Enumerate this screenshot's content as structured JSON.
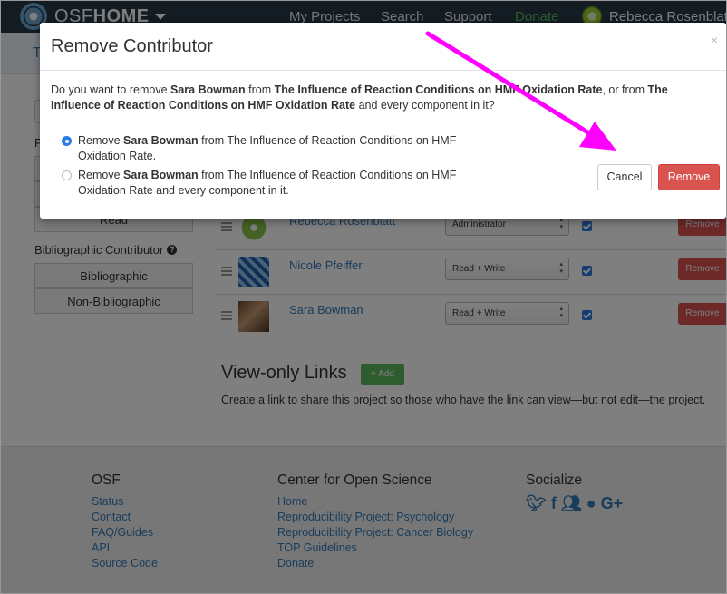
{
  "navbar": {
    "brand_osf": "OSF",
    "brand_home": "HOME",
    "links": [
      "My Projects",
      "Search",
      "Support",
      "Donate"
    ],
    "user_name": "Rebecca Rosenblatt"
  },
  "subnav": {
    "title_fragment": "T"
  },
  "sidebar": {
    "permission_label_fragment": "P",
    "read_label": "Read",
    "biblio_label": "Bibliographic Contributor",
    "biblio_options": [
      "Bibliographic",
      "Non-Bibliographic"
    ]
  },
  "contributors": [
    {
      "name": "Rebecca Rosenblatt",
      "permission": "Administrator",
      "remove": "Remove"
    },
    {
      "name": "Nicole Pfeiffer",
      "permission": "Read + Write",
      "remove": "Remove"
    },
    {
      "name": "Sara Bowman",
      "permission": "Read + Write",
      "remove": "Remove"
    }
  ],
  "view_only": {
    "title": "View-only Links",
    "add_label": "+ Add",
    "description": "Create a link to share this project so those who have the link can view—but not edit—the project."
  },
  "footer": {
    "osf": {
      "heading": "OSF",
      "links": [
        "Status",
        "Contact",
        "FAQ/Guides",
        "API",
        "Source Code"
      ]
    },
    "cos": {
      "heading": "Center for Open Science",
      "links": [
        "Home",
        "Reproducibility Project: Psychology",
        "Reproducibility Project: Cancer Biology",
        "TOP Guidelines",
        "Donate"
      ]
    },
    "social": {
      "heading": "Socialize",
      "icons": [
        "twitter-icon",
        "facebook-icon",
        "group-icon",
        "github-icon",
        "google-plus-icon"
      ]
    }
  },
  "modal": {
    "title": "Remove Contributor",
    "close": "×",
    "question_1": "Do you want to remove ",
    "person": "Sara Bowman",
    "question_2": " from ",
    "project": "The Influence of Reaction Conditions on HMF Oxidation Rate",
    "question_3": ", or from ",
    "question_4": " and every component in it?",
    "option_1_prefix": "Remove ",
    "option_1_suffix": " from The Influence of Reaction Conditions on HMF Oxidation Rate.",
    "option_2_prefix": "Remove ",
    "option_2_suffix": " from The Influence of Reaction Conditions on HMF Oxidation Rate and every component in it.",
    "selected_option": 1,
    "cancel_label": "Cancel",
    "remove_label": "Remove"
  },
  "colors": {
    "accent": "#337ab7",
    "danger": "#d9534f",
    "success": "#5cb85c",
    "annotation": "#ff00ff",
    "navbar": "#263947"
  }
}
